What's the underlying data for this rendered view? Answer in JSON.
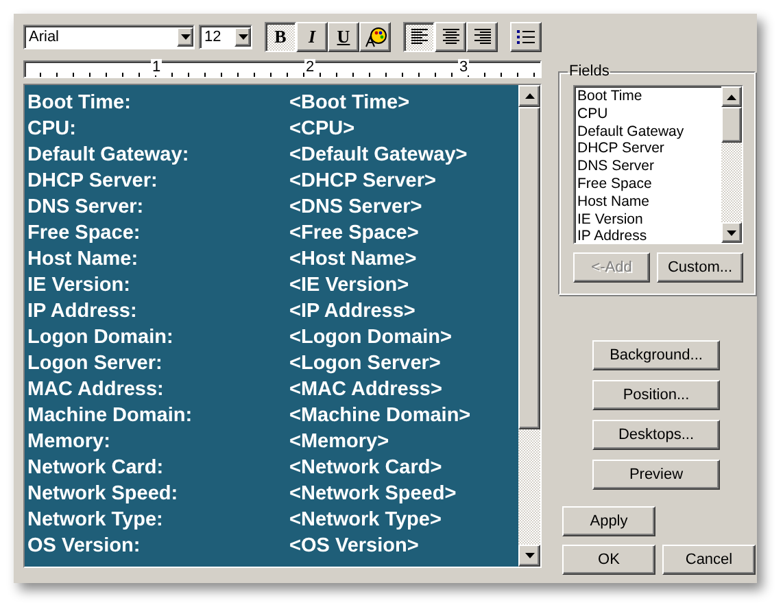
{
  "toolbar": {
    "font": "Arial",
    "size": "12",
    "format_buttons": [
      {
        "kind": "bold",
        "label": "B",
        "selected": true
      },
      {
        "kind": "italic",
        "label": "I",
        "selected": false
      },
      {
        "kind": "underline",
        "label": "U",
        "selected": false
      },
      {
        "kind": "color",
        "selected": false
      }
    ],
    "align_buttons": [
      {
        "kind": "left",
        "selected": true
      },
      {
        "kind": "center",
        "selected": false
      },
      {
        "kind": "right",
        "selected": false
      }
    ],
    "bullets": {
      "selected": false
    }
  },
  "ruler": {
    "labels": [
      "1",
      "2",
      "3"
    ]
  },
  "editor": {
    "rows": [
      {
        "label": "Boot Time:",
        "value": "<Boot Time>"
      },
      {
        "label": "CPU:",
        "value": "<CPU>"
      },
      {
        "label": "Default Gateway:",
        "value": "<Default Gateway>"
      },
      {
        "label": "DHCP Server:",
        "value": "<DHCP Server>"
      },
      {
        "label": "DNS Server:",
        "value": "<DNS Server>"
      },
      {
        "label": "Free Space:",
        "value": "<Free Space>"
      },
      {
        "label": "Host Name:",
        "value": "<Host Name>"
      },
      {
        "label": "IE Version:",
        "value": "<IE Version>"
      },
      {
        "label": "IP Address:",
        "value": "<IP Address>"
      },
      {
        "label": "Logon Domain:",
        "value": "<Logon Domain>"
      },
      {
        "label": "Logon Server:",
        "value": "<Logon Server>"
      },
      {
        "label": "MAC Address:",
        "value": "<MAC Address>"
      },
      {
        "label": "Machine Domain:",
        "value": "<Machine Domain>"
      },
      {
        "label": "Memory:",
        "value": "<Memory>"
      },
      {
        "label": "Network Card:",
        "value": "<Network Card>"
      },
      {
        "label": "Network Speed:",
        "value": "<Network Speed>"
      },
      {
        "label": "Network Type:",
        "value": "<Network Type>"
      },
      {
        "label": "OS Version:",
        "value": "<OS Version>"
      }
    ]
  },
  "fields": {
    "title": "Fields",
    "items": [
      "Boot Time",
      "CPU",
      "Default Gateway",
      "DHCP Server",
      "DNS Server",
      "Free Space",
      "Host Name",
      "IE Version",
      "IP Address"
    ],
    "buttons": [
      {
        "label": "<-Add",
        "disabled": true
      },
      {
        "label": "Custom...",
        "disabled": false
      }
    ]
  },
  "side_buttons": [
    "Background...",
    "Position...",
    "Desktops...",
    "Preview"
  ],
  "footer": {
    "apply": "Apply",
    "ok": "OK",
    "cancel": "Cancel"
  }
}
